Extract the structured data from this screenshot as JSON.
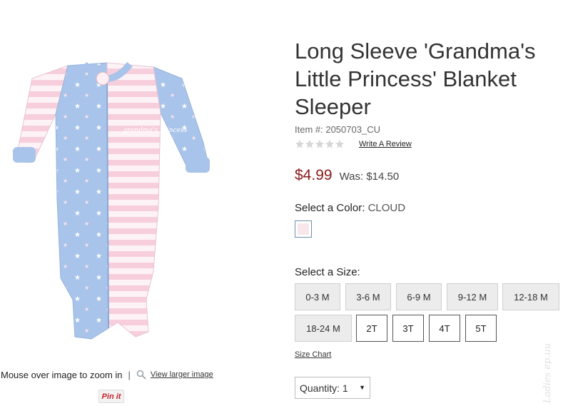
{
  "product": {
    "title": "Long Sleeve 'Grandma's Little Princess' Blanket Sleeper",
    "item_number": "Item #: 2050703_CU",
    "rating_stars": 0,
    "rating_max": 5,
    "write_review": "Write A Review",
    "sale_price": "$4.99",
    "was_price": "Was: $14.50",
    "image_print": "grandma's princess"
  },
  "color": {
    "label": "Select a Color:",
    "value": "CLOUD",
    "swatch_color": "#f7e7ea"
  },
  "size": {
    "label": "Select a Size:",
    "options": [
      {
        "label": "0-3 M",
        "available": false
      },
      {
        "label": "3-6 M",
        "available": false
      },
      {
        "label": "6-9 M",
        "available": false
      },
      {
        "label": "9-12 M",
        "available": false
      },
      {
        "label": "12-18 M",
        "available": false
      },
      {
        "label": "18-24 M",
        "available": false
      },
      {
        "label": "2T",
        "available": true
      },
      {
        "label": "3T",
        "available": true
      },
      {
        "label": "4T",
        "available": true
      },
      {
        "label": "5T",
        "available": true
      }
    ],
    "chart_link": "Size Chart"
  },
  "quantity": {
    "label": "Quantity:",
    "value": "1"
  },
  "image_controls": {
    "zoom_hint": "Mouse over image to zoom in",
    "separator": "|",
    "view_larger": "View larger image",
    "pin_label": "Pin it"
  },
  "watermark": "Ladies ep.uu",
  "colors": {
    "sale_price": "#8b1a1a",
    "sleeper_blue": "#a9c4ea",
    "sleeper_pink": "#f9dde5"
  }
}
